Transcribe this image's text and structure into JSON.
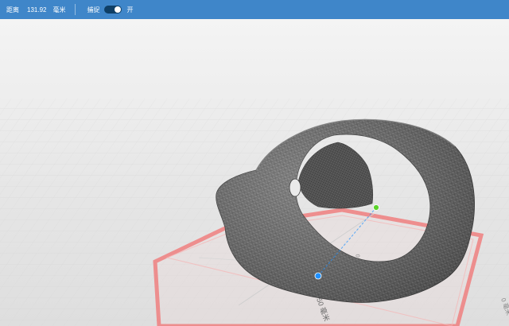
{
  "toolbar": {
    "distance_label": "距离",
    "distance_value": "131.92",
    "distance_unit": "毫米",
    "snap_label": "捕捉",
    "snap_state": "开",
    "snap_enabled": true
  },
  "viewport": {
    "ruler_front_label": "50 毫米",
    "ruler_back_label": "0",
    "ruler_right_label": "0 毫米",
    "colors": {
      "build_plate_outline": "#f08080",
      "mesh_fill": "#6f6f6f",
      "point_start": "#1e90ff",
      "point_end": "#5bd42a",
      "toolbar": "#3f86c9"
    }
  }
}
